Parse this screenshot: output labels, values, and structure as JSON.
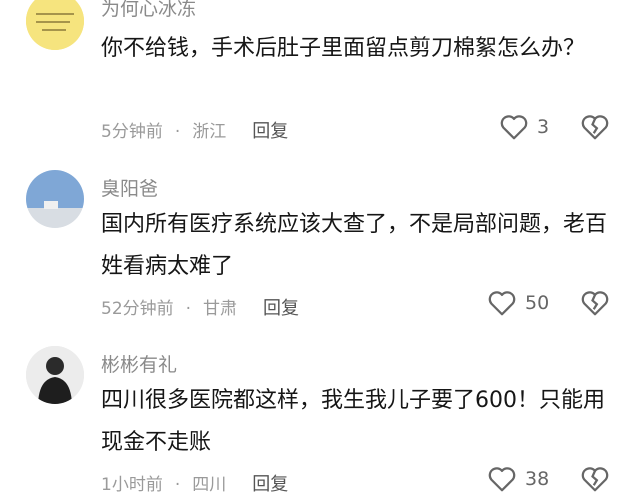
{
  "comments": [
    {
      "username": "为何心冰冻",
      "text": "你不给钱，手术后肚子里面留点剪刀棉絮怎么办？",
      "time": "5分钟前",
      "location": "浙江",
      "reply_label": "回复",
      "likes": "3",
      "avatar_icon": "note-paper-avatar-icon"
    },
    {
      "username": "臭阳爸",
      "text": "国内所有医疗系统应该大查了，不是局部问题，老百姓看病太难了",
      "time": "52分钟前",
      "location": "甘肃",
      "reply_label": "回复",
      "likes": "50",
      "avatar_icon": "sky-landscape-avatar-icon"
    },
    {
      "username": "彬彬有礼",
      "text": "四川很多医院都这样，我生我儿子要了600！只能用现金不走账",
      "time": "1小时前",
      "location": "四川",
      "reply_label": "回复",
      "likes": "38",
      "avatar_icon": "person-avatar-icon"
    }
  ],
  "colors": {
    "username": "#8a8a8a",
    "text": "#161616",
    "meta": "#9a9a9a"
  }
}
